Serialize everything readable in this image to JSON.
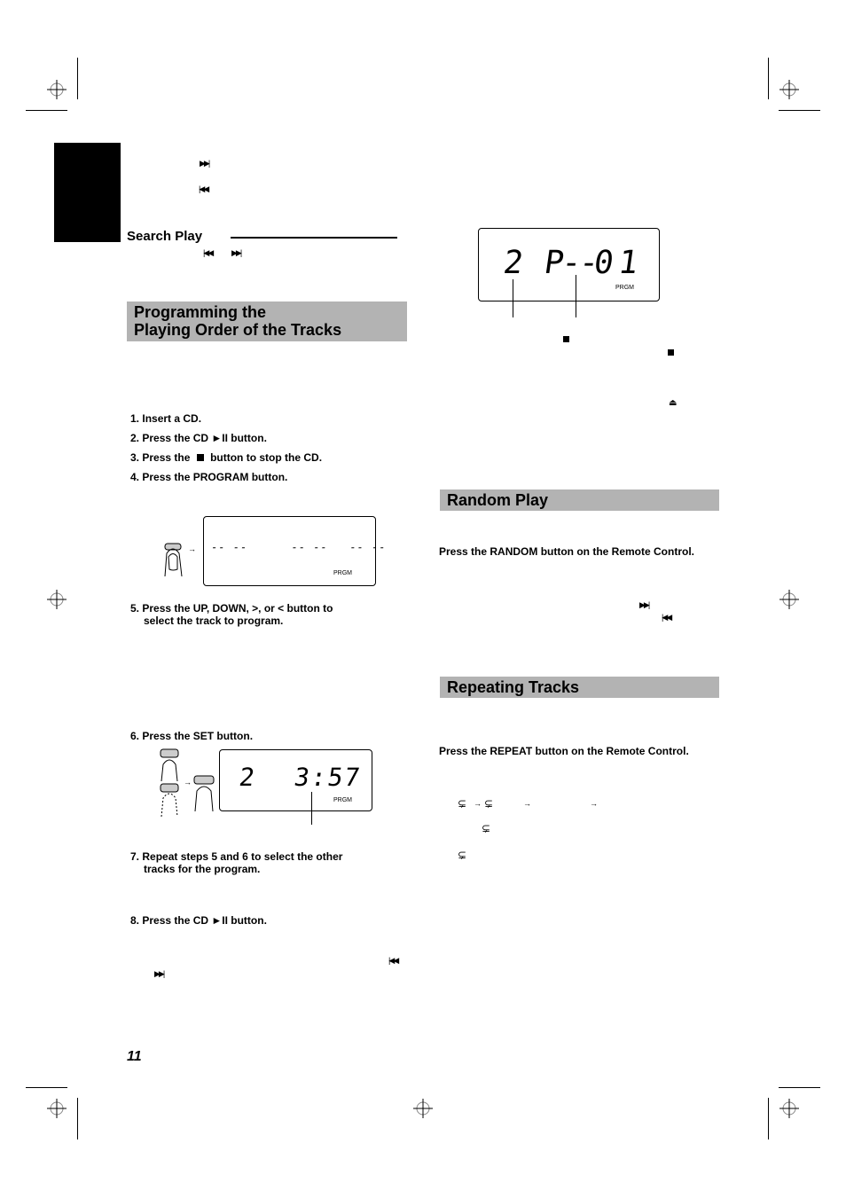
{
  "page": {
    "number": "11"
  },
  "search_play": {
    "title": "Search Play",
    "icons": [
      "skip-back-icon",
      "skip-forward-icon"
    ]
  },
  "top_icons": {
    "skip_forward": "▶▶|",
    "skip_back": "|◀◀"
  },
  "programming": {
    "title_line1": "Programming the",
    "title_line2": "Playing Order of the Tracks",
    "steps": [
      {
        "num": "1.",
        "text": "Insert a CD."
      },
      {
        "num": "2.",
        "text": "Press the CD ►II button."
      },
      {
        "num": "3.",
        "text_before": "Press the",
        "text_after": "button to stop the CD."
      },
      {
        "num": "4.",
        "text": "Press the PROGRAM button."
      },
      {
        "num": "5.",
        "line1": "Press the UP, DOWN, >, or  < button to",
        "line2": "select the track to program."
      },
      {
        "num": "6.",
        "text": "Press the SET button."
      },
      {
        "num": "7.",
        "line1": "Repeat steps 5 and 6 to select the other",
        "line2": "tracks for the program."
      },
      {
        "num": "8.",
        "text": "Press the CD ►II button."
      }
    ],
    "display1": {
      "segments": "-- --      -- --   -- --",
      "indicator": "PRGM"
    },
    "display2": {
      "track": "2",
      "time": "3:57",
      "indicator": "PRGM"
    }
  },
  "program_display": {
    "track": "2",
    "program_label": "P--",
    "program_number": "01",
    "indicator": "PRGM"
  },
  "random_play": {
    "title": "Random Play",
    "instruction": "Press the RANDOM button on the Remote Control."
  },
  "repeating": {
    "title": "Repeating Tracks",
    "instruction": "Press the REPEAT button on the Remote Control."
  },
  "glyphs": {
    "skip_forward": "▶▶|",
    "skip_back": "|◀◀",
    "eject": "⏏",
    "arrow_right": "→",
    "repeat": "⊊"
  }
}
